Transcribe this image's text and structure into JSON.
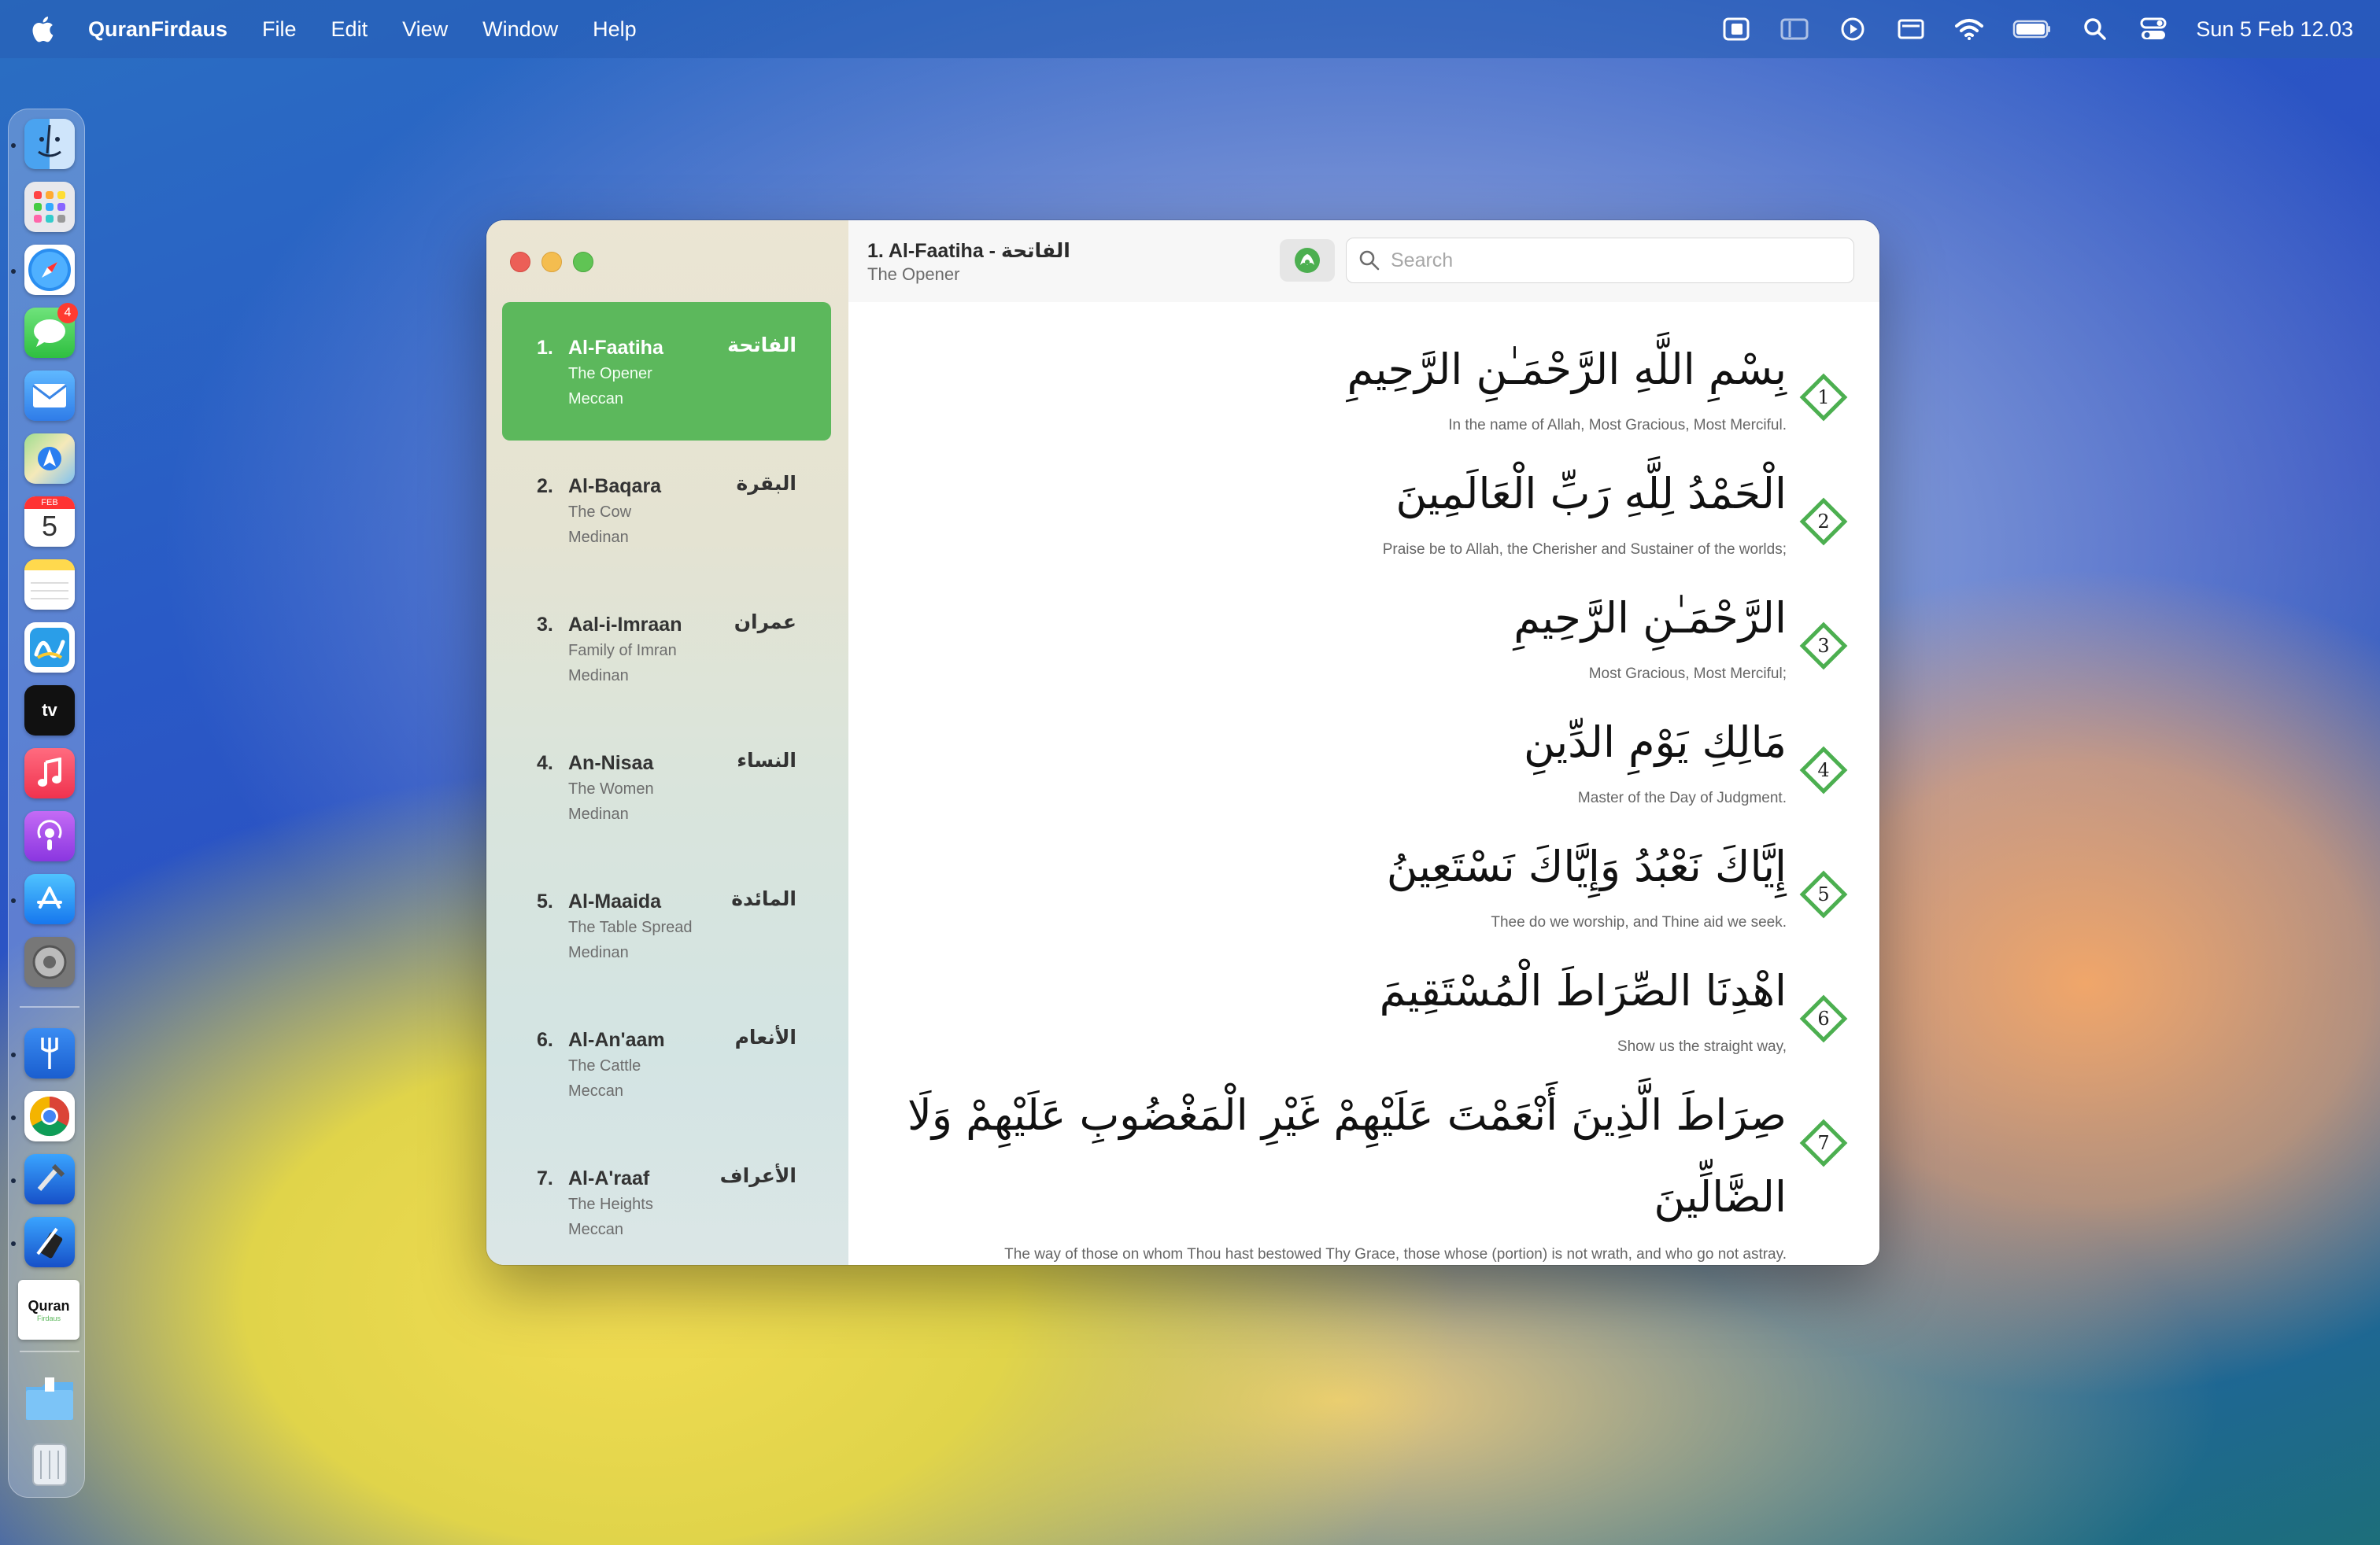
{
  "menubar": {
    "app_name": "QuranFirdaus",
    "menus": [
      "File",
      "Edit",
      "View",
      "Window",
      "Help"
    ],
    "clock": "Sun 5 Feb  12.03",
    "status_icons": [
      "stage-manager-icon",
      "sidebar-icon",
      "play-icon",
      "display-icon",
      "wifi-icon",
      "battery-icon",
      "spotlight-search-icon",
      "control-center-icon"
    ]
  },
  "dock": {
    "messages_badge": "4",
    "calendar": {
      "month": "FEB",
      "day": "5"
    },
    "quran_tile": {
      "title": "Quran",
      "subtitle": "Firdaus"
    }
  },
  "toolbar": {
    "title": "1. Al-Faatiha - الفاتحة",
    "subtitle": "The Opener",
    "search_placeholder": "Search"
  },
  "sidebar": {
    "surahs": [
      {
        "num": "1.",
        "name": "Al-Faatiha",
        "translation": "The Opener",
        "type": "Meccan",
        "arabic": "الفاتحة",
        "selected": true
      },
      {
        "num": "2.",
        "name": "Al-Baqara",
        "translation": "The Cow",
        "type": "Medinan",
        "arabic": "البقرة",
        "selected": false
      },
      {
        "num": "3.",
        "name": "Aal-i-Imraan",
        "translation": "Family of Imran",
        "type": "Medinan",
        "arabic": "عمران",
        "selected": false
      },
      {
        "num": "4.",
        "name": "An-Nisaa",
        "translation": "The Women",
        "type": "Medinan",
        "arabic": "النساء",
        "selected": false
      },
      {
        "num": "5.",
        "name": "Al-Maaida",
        "translation": "The Table Spread",
        "type": "Medinan",
        "arabic": "المائدة",
        "selected": false
      },
      {
        "num": "6.",
        "name": "Al-An'aam",
        "translation": "The Cattle",
        "type": "Meccan",
        "arabic": "الأنعام",
        "selected": false
      },
      {
        "num": "7.",
        "name": "Al-A'raaf",
        "translation": "The Heights",
        "type": "Meccan",
        "arabic": "الأعراف",
        "selected": false
      }
    ]
  },
  "verses": [
    {
      "number": "1",
      "arabic": "بِسْمِ اللَّهِ الرَّحْمَـٰنِ الرَّحِيمِ",
      "translation": "In the name of Allah, Most Gracious, Most Merciful."
    },
    {
      "number": "2",
      "arabic": "الْحَمْدُ لِلَّهِ رَبِّ الْعَالَمِينَ",
      "translation": "Praise be to Allah, the Cherisher and Sustainer of the worlds;"
    },
    {
      "number": "3",
      "arabic": "الرَّحْمَـٰنِ الرَّحِيمِ",
      "translation": "Most Gracious, Most Merciful;"
    },
    {
      "number": "4",
      "arabic": "مَالِكِ يَوْمِ الدِّينِ",
      "translation": "Master of the Day of Judgment."
    },
    {
      "number": "5",
      "arabic": "إِيَّاكَ نَعْبُدُ وَإِيَّاكَ نَسْتَعِينُ",
      "translation": "Thee do we worship, and Thine aid we seek."
    },
    {
      "number": "6",
      "arabic": "اهْدِنَا الصِّرَاطَ الْمُسْتَقِيمَ",
      "translation": "Show us the straight way,"
    },
    {
      "number": "7",
      "arabic_line1": "صِرَاطَ الَّذِينَ أَنْعَمْتَ عَلَيْهِمْ غَيْرِ الْمَغْضُوبِ عَلَيْهِمْ وَلَا",
      "arabic_line2": "الضَّالِّينَ",
      "translation": "The way of those on whom Thou hast bestowed Thy Grace, those whose (portion) is not wrath, and who go not astray."
    }
  ],
  "colors": {
    "accent_green": "#5cb85c",
    "badge_green": "#4caf50"
  }
}
